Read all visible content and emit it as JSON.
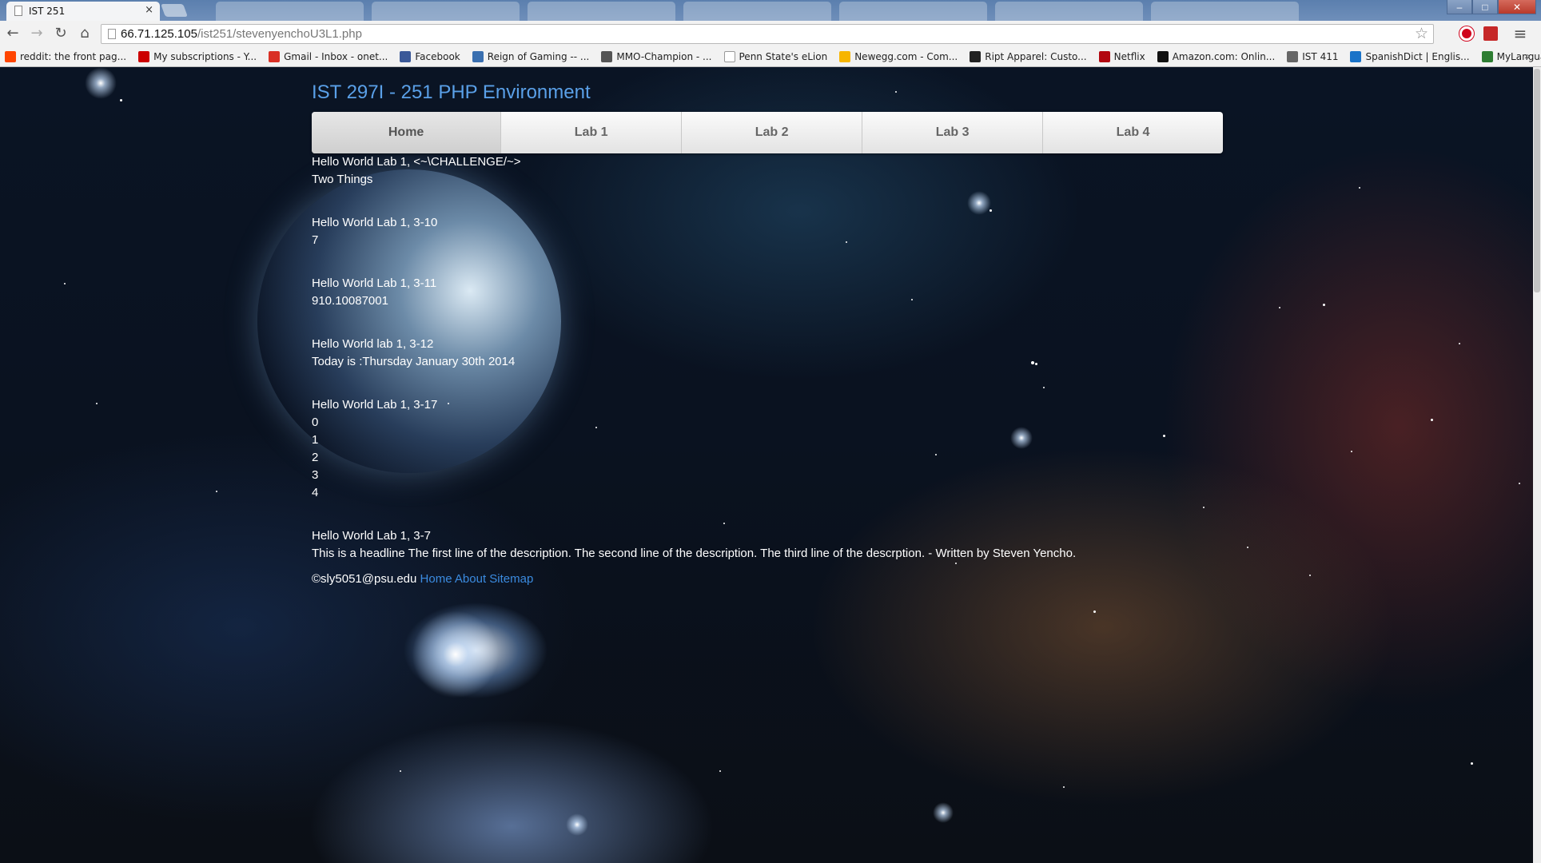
{
  "browser": {
    "tab_title": "IST 251",
    "tab_close": "×",
    "url_host": "66.71.125.105",
    "url_path": "/ist251/stevenyenchoU3L1.php",
    "nav_back": "←",
    "nav_forward": "→",
    "nav_reload": "↻",
    "nav_home": "⌂",
    "star": "☆",
    "menu": "≡",
    "bookmarks": [
      {
        "label": "reddit: the front pag...",
        "icon": "reddit-icon",
        "color": "#ff4500"
      },
      {
        "label": "My subscriptions - Y...",
        "icon": "youtube-icon",
        "color": "#cc0000"
      },
      {
        "label": "Gmail - Inbox - onet...",
        "icon": "gmail-icon",
        "color": "#d93025"
      },
      {
        "label": "Facebook",
        "icon": "facebook-icon",
        "color": "#3b5998"
      },
      {
        "label": "Reign of Gaming -- ...",
        "icon": "reign-icon",
        "color": "#3a6fb0"
      },
      {
        "label": "MMO-Champion - ...",
        "icon": "mmo-icon",
        "color": "#555555"
      },
      {
        "label": "Penn State's eLion",
        "icon": "page-icon",
        "color": "#ffffff"
      },
      {
        "label": "Newegg.com - Com...",
        "icon": "newegg-icon",
        "color": "#f7b500"
      },
      {
        "label": "Ript Apparel: Custo...",
        "icon": "ript-icon",
        "color": "#222222"
      },
      {
        "label": "Netflix",
        "icon": "netflix-icon",
        "color": "#b20710"
      },
      {
        "label": "Amazon.com: Onlin...",
        "icon": "amazon-icon",
        "color": "#111111"
      },
      {
        "label": "IST 411",
        "icon": "ist-icon",
        "color": "#666666"
      },
      {
        "label": "SpanishDict | Englis...",
        "icon": "spanishdict-icon",
        "color": "#1a73c8"
      },
      {
        "label": "MyLanguageLabs | ...",
        "icon": "mylanguagelabs-icon",
        "color": "#2e7d32"
      }
    ],
    "bookmarks_more": "»"
  },
  "page": {
    "site_title": "IST 297I - 251 PHP Environment",
    "nav": [
      "Home",
      "Lab 1",
      "Lab 2",
      "Lab 3",
      "Lab 4"
    ],
    "blocks": [
      {
        "lines": [
          "Hello World Lab 1, <~\\CHALLENGE/~>",
          "Two Things"
        ]
      },
      {
        "lines": [
          "Hello World Lab 1, 3-10",
          "7"
        ]
      },
      {
        "lines": [
          "Hello World Lab 1, 3-11",
          "910.10087001"
        ]
      },
      {
        "lines": [
          "Hello World lab 1, 3-12",
          "Today is :Thursday January 30th 2014"
        ]
      },
      {
        "lines": [
          "Hello World Lab 1, 3-17",
          "0",
          "1",
          "2",
          "3",
          "4"
        ]
      },
      {
        "lines": [
          "Hello World Lab 1, 3-7",
          "This is a headline The first line of the description. The second line of the description. The third line of the descrption. - Written by Steven Yencho."
        ]
      }
    ],
    "footer": {
      "copyright": "©sly5051@psu.edu",
      "links": [
        "Home",
        "About",
        "Sitemap"
      ]
    }
  }
}
